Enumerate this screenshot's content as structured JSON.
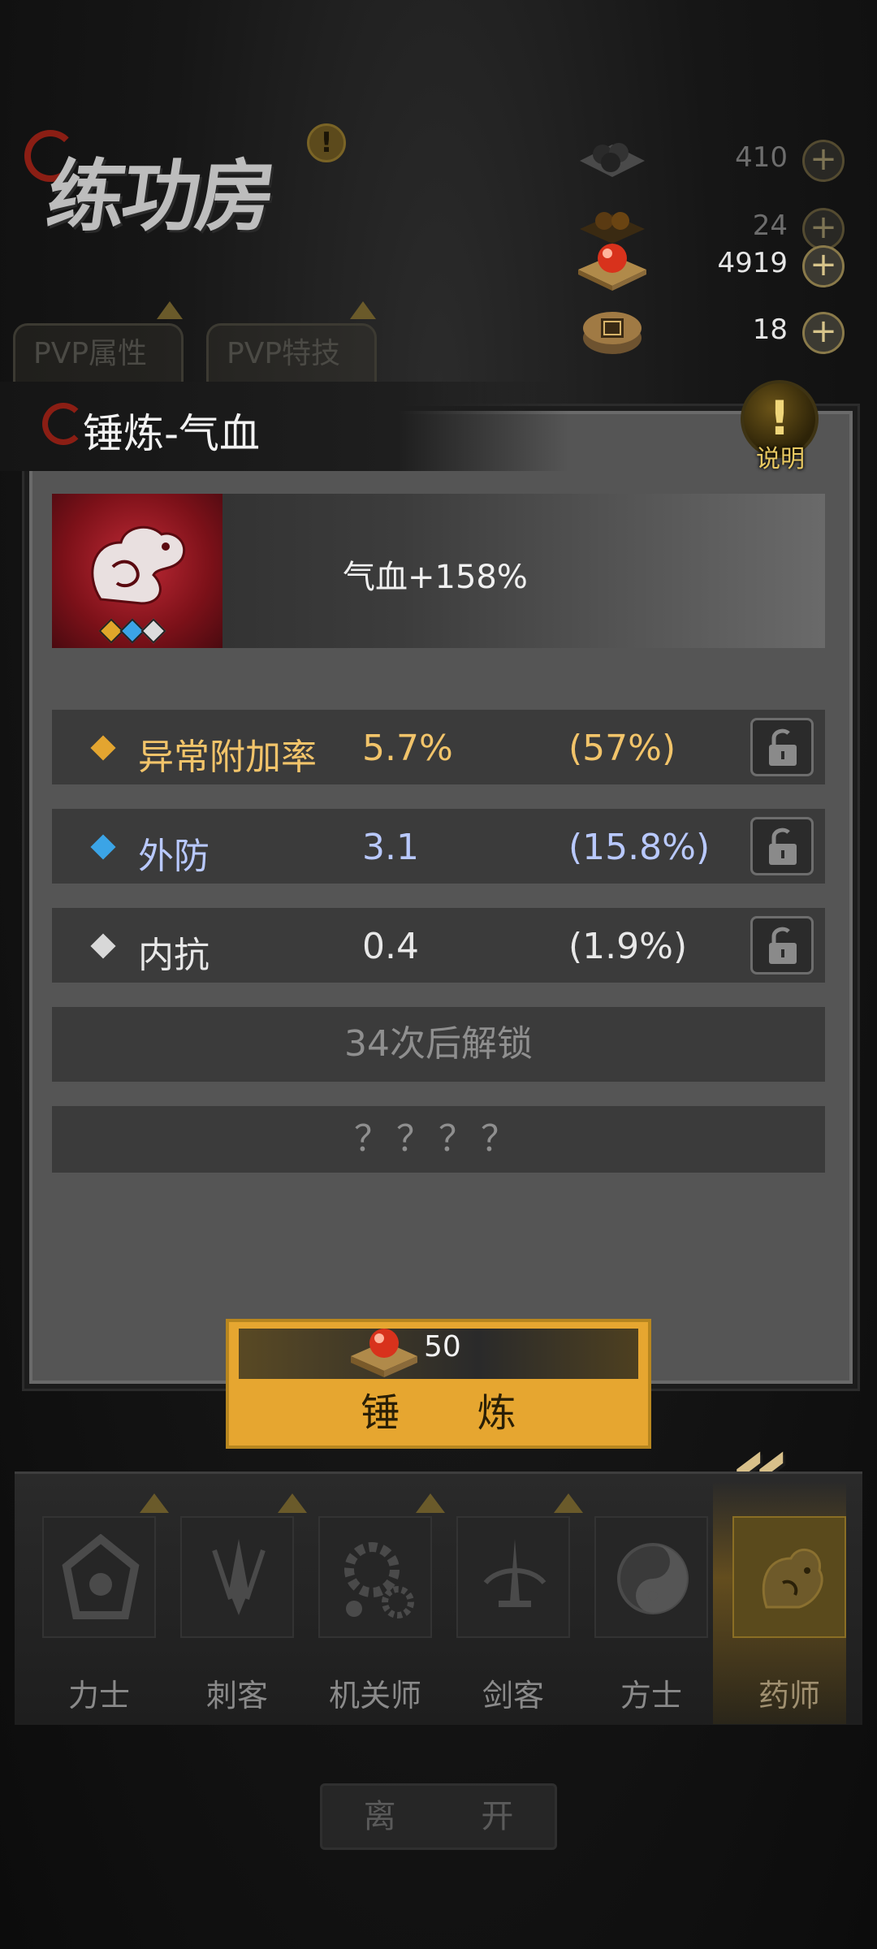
{
  "header": {
    "title": "练功房",
    "tabs": [
      {
        "label": "PVP属性"
      },
      {
        "label": "PVP特技"
      }
    ]
  },
  "resources": [
    {
      "icon": "dark-pearls-icon",
      "value": "410"
    },
    {
      "icon": "bronze-pearls-icon",
      "value": "24"
    },
    {
      "icon": "red-orb-icon",
      "value": "4919"
    },
    {
      "icon": "seal-box-icon",
      "value": "18"
    }
  ],
  "panel": {
    "title": "锤炼-气血",
    "help_label": "说明",
    "item": {
      "icon": "crimson-beast-icon",
      "bonus": "气血+158%"
    },
    "attributes": [
      {
        "name": "异常附加率",
        "value": "5.7%",
        "percent": "(57%)",
        "color": "#f2c46a"
      },
      {
        "name": "外防",
        "value": "3.1",
        "percent": "(15.8%)",
        "color": "#b9c9ff"
      },
      {
        "name": "内抗",
        "value": "0.4",
        "percent": "(1.9%)",
        "color": "#e8e8e8"
      }
    ],
    "unlock_text": "34次后解锁",
    "unknown_text": "？？？？",
    "forge": {
      "cost": "50",
      "label": "锤 炼"
    }
  },
  "classes": [
    {
      "label": "力士",
      "icon": "shield-icon"
    },
    {
      "label": "刺客",
      "icon": "blade-icon"
    },
    {
      "label": "机关师",
      "icon": "gears-icon"
    },
    {
      "label": "剑客",
      "icon": "sword-icon"
    },
    {
      "label": "方士",
      "icon": "yin-yang-icon"
    },
    {
      "label": "药师",
      "icon": "herb-beast-icon"
    }
  ],
  "active_class": "药师",
  "leave_label": "离 开",
  "colors": {
    "accent_gold": "#e6a630",
    "panel_bg": "#555555",
    "row_bg": "#3b3b3b"
  }
}
